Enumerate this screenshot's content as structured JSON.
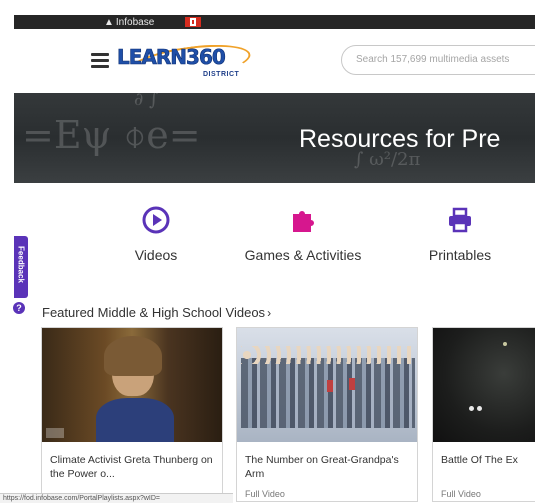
{
  "topbar": {
    "brand_label": "Infobase"
  },
  "header": {
    "logo_text": "LEARN360",
    "logo_subtext": "DISTRICT",
    "search_placeholder": "Search 157,699 multimedia assets"
  },
  "banner": {
    "title": "Resources for Pre"
  },
  "categories": [
    {
      "label": "Videos",
      "icon": "play-circle-icon",
      "color": "#5a33b8"
    },
    {
      "label": "Games & Activities",
      "icon": "puzzle-icon",
      "color": "#d6178e"
    },
    {
      "label": "Printables",
      "icon": "printer-icon",
      "color": "#5a33b8"
    }
  ],
  "feedback": {
    "label": "Feedback"
  },
  "featured": {
    "title": "Featured Middle & High School Videos",
    "cards": [
      {
        "title": "Climate Activist Greta Thunberg on the Power o...",
        "type": ""
      },
      {
        "title": "The Number on Great-Grandpa's Arm",
        "type": "Full Video"
      },
      {
        "title": "Battle Of The Ex",
        "type": "Full Video"
      }
    ]
  },
  "statusbar": {
    "text": "https://fod.infobase.com/PortalPlaylists.aspx?wID="
  },
  "colors": {
    "accent": "#5a33b8",
    "magenta": "#d6178e"
  }
}
